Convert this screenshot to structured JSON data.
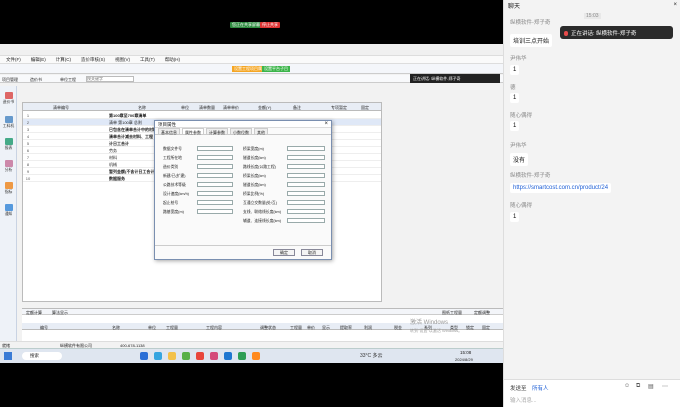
{
  "top": {
    "chip_green": "您正在共享屏幕",
    "chip_red": "停止共享"
  },
  "app": {
    "menu": [
      "文件(F)",
      "编辑(E)",
      "计算(C)",
      "造价审核(S)",
      "视图(V)",
      "工具(T)",
      "帮助(H)"
    ],
    "toolbar_chips": [
      "设置工程项目属性",
      "设置平台子目"
    ],
    "project_label": "项目管理",
    "tabs": [
      "造价书",
      "单位工程",
      "预算书",
      "费用汇总"
    ],
    "search_placeholder": "按关键字",
    "speaking_tip": "正在讲话: 纵横软件-郑子奇",
    "column_headers": [
      "清单编号",
      "名称",
      "单位",
      "清单数量",
      "清单单价",
      "金额(Y)",
      "备注",
      "专项暂定",
      "固定"
    ],
    "rows": [
      {
        "num": "1",
        "code": "",
        "name": "第100章至700章清单"
      },
      {
        "num": "2",
        "code": "",
        "name": "清单 第100章 总则"
      },
      {
        "num": "3",
        "code": "",
        "name": "已包含在清单合计中的材料"
      },
      {
        "num": "4",
        "code": "",
        "name": "清单合计减去材料、工程"
      },
      {
        "num": "5",
        "code": "",
        "name": "计日工合计"
      },
      {
        "num": "6",
        "code": "",
        "name": "劳务"
      },
      {
        "num": "7",
        "code": "",
        "name": "材料"
      },
      {
        "num": "8",
        "code": "",
        "name": "机械"
      },
      {
        "num": "9",
        "code": "",
        "name": "暂列金额(不含计日工合计)"
      },
      {
        "num": "10",
        "code": "",
        "name": "数据服务"
      }
    ],
    "nav": [
      "造价书",
      "工料机",
      "报表",
      "分析",
      "指标",
      "通知"
    ],
    "bottom_tabs": [
      "定额计算",
      "算法显示"
    ],
    "bottom_right": [
      "图纸工程量",
      "定额调整"
    ],
    "bottom_headers": [
      "编号",
      "名称",
      "单位",
      "工程量",
      "工程内容",
      "调整状态",
      "工程量",
      "单价",
      "显示",
      "提取率",
      "利润",
      "税金",
      "系列",
      "类型",
      "锁定",
      "固定"
    ],
    "status_left": "就绪",
    "status_company": "纵横软件有限公司",
    "status_phone": "400-678-1138"
  },
  "dialog": {
    "title": "项目属性",
    "tabs": [
      "基本信息",
      "属性参数",
      "计算参数",
      "小数位数",
      "其他"
    ],
    "left_fields": [
      "数据文件号",
      "工程所在地",
      "造价类别",
      "新建/已(扩建)",
      "公路技术等级",
      "设计速度(km/h)",
      "起止桩号",
      "路基宽度(m)"
    ],
    "right_fields": [
      "桥梁宽度(m)",
      "隧道长度(km)",
      "路线长度(公路工程)",
      "桥梁长度(km)",
      "隧道长度(km)",
      "桥梁比例(%)",
      "互通立交数量(处/互)",
      "支线、联络线长度(km)",
      "辅道、连接线长度(km)"
    ],
    "ok": "确定",
    "cancel": "取消"
  },
  "taskbar": {
    "search": "搜索",
    "weather": "33°C 多云",
    "time": "15:08",
    "date": "2024/8/29"
  },
  "watermark": {
    "line1": "激活 Windows",
    "line2": "转到\"设置\"以激活 Windows。"
  },
  "chat": {
    "title": "聊天",
    "speaking": "正在讲话: 纵横软件-郑子奇",
    "messages": [
      {
        "sender": "纵横软件-郑子奇",
        "text": "培训三点开始",
        "time": "15:03"
      },
      {
        "sender": "尹伟华",
        "text": "1"
      },
      {
        "sender": "德",
        "text": "1"
      },
      {
        "sender": "随心偶得",
        "text": "1"
      },
      {
        "sender": "尹伟华",
        "text": "没有"
      },
      {
        "sender": "纵横软件-郑子奇",
        "text": "https://smartcost.com.cn/product/24",
        "link": true
      },
      {
        "sender": "随心偶得",
        "text": "1"
      }
    ],
    "send_to_label": "发送至",
    "send_to_value": "所有人",
    "input_placeholder": "输入消息..."
  },
  "colors": {
    "accent_green": "#3cb54a",
    "accent_red": "#e14b4b",
    "link": "#1e5fd6"
  }
}
